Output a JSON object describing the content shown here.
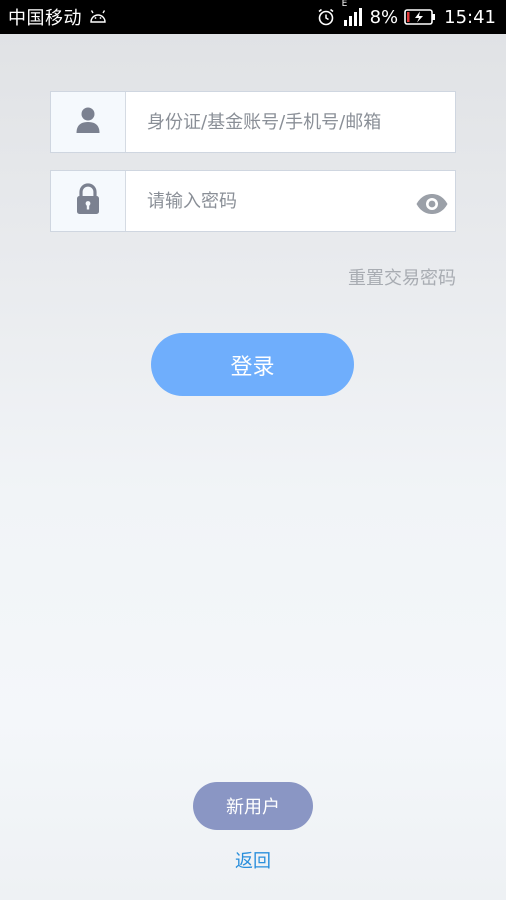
{
  "status_bar": {
    "carrier": "中国移动",
    "network_type": "E",
    "battery": "8%",
    "time": "15:41",
    "icons": [
      "android-icon",
      "alarm-icon",
      "signal-icon",
      "battery-charging-icon"
    ]
  },
  "login_form": {
    "account_field": {
      "placeholder": "身份证/基金账号/手机号/邮箱",
      "value": "",
      "icon": "user-icon"
    },
    "password_field": {
      "placeholder": "请输入密码",
      "value": "",
      "icon": "lock-icon",
      "toggle_icon": "eye-icon"
    },
    "reset_password_label": "重置交易密码",
    "login_label": "登录"
  },
  "footer": {
    "new_user_label": "新用户",
    "back_label": "返回"
  },
  "colors": {
    "login_button": "#6faefc",
    "new_user_button": "#8a96c4",
    "back_link": "#2a8fdc",
    "reset_link": "#a8acb2"
  }
}
